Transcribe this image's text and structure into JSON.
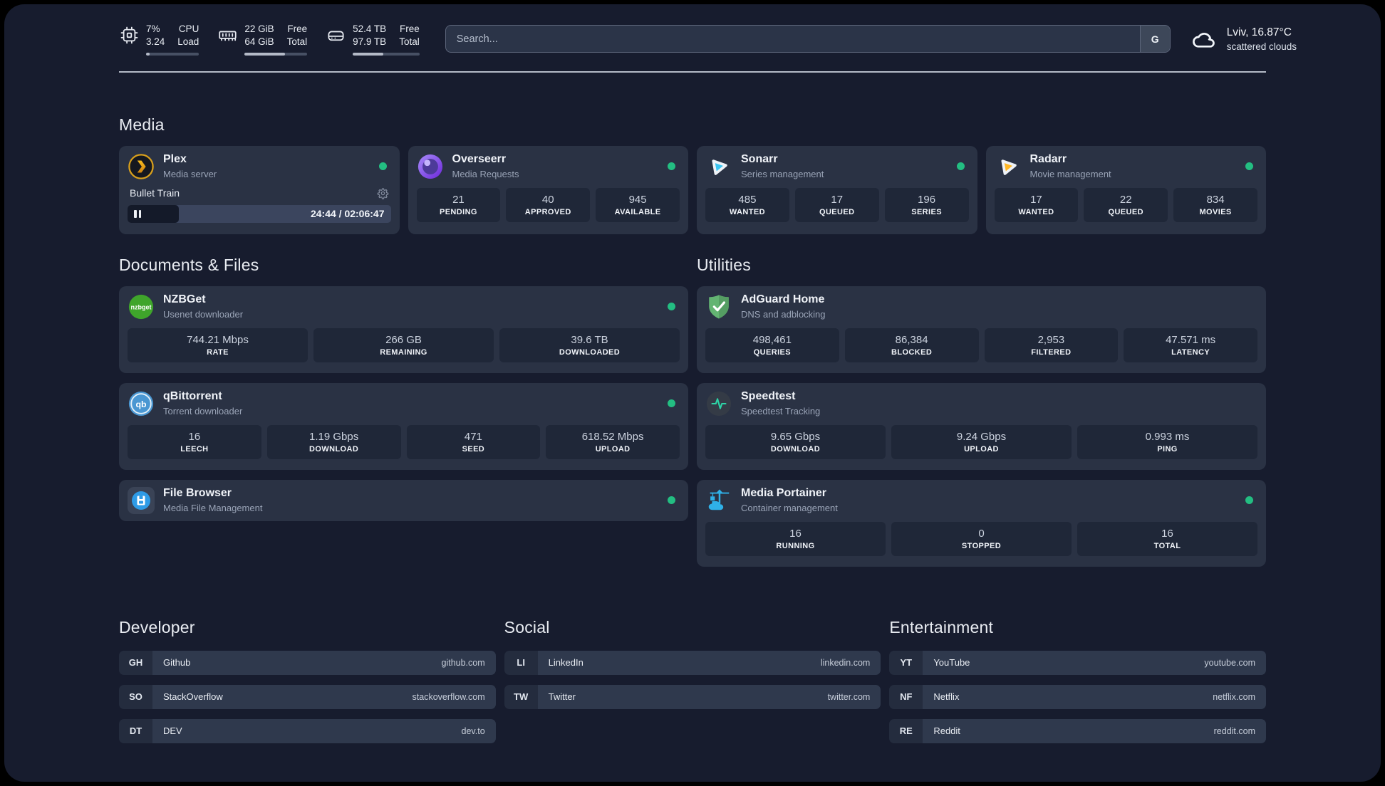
{
  "header": {
    "resources": [
      {
        "name": "cpu",
        "line1": "7%",
        "line2": "3.24",
        "label1": "CPU",
        "label2": "Load",
        "progress_pct": 7
      },
      {
        "name": "memory",
        "line1": "22 GiB",
        "line2": "64 GiB",
        "label1": "Free",
        "label2": "Total",
        "progress_pct": 64
      },
      {
        "name": "disk",
        "line1": "52.4 TB",
        "line2": "97.9 TB",
        "label1": "Free",
        "label2": "Total",
        "progress_pct": 46
      }
    ],
    "search": {
      "placeholder": "Search...",
      "button_label": "G"
    },
    "weather": {
      "title": "Lviv, 16.87°C",
      "subtitle": "scattered clouds"
    }
  },
  "media": {
    "title": "Media",
    "plex": {
      "name": "Plex",
      "description": "Media server",
      "status": "online",
      "player": {
        "title": "Bullet Train",
        "time": "24:44 / 02:06:47",
        "progress_pct": 19.5
      }
    },
    "overseerr": {
      "name": "Overseerr",
      "description": "Media Requests",
      "status": "online",
      "stats": [
        {
          "value": "21",
          "label": "PENDING"
        },
        {
          "value": "40",
          "label": "APPROVED"
        },
        {
          "value": "945",
          "label": "AVAILABLE"
        }
      ]
    },
    "sonarr": {
      "name": "Sonarr",
      "description": "Series management",
      "status": "online",
      "stats": [
        {
          "value": "485",
          "label": "WANTED"
        },
        {
          "value": "17",
          "label": "QUEUED"
        },
        {
          "value": "196",
          "label": "SERIES"
        }
      ]
    },
    "radarr": {
      "name": "Radarr",
      "description": "Movie management",
      "status": "online",
      "stats": [
        {
          "value": "17",
          "label": "WANTED"
        },
        {
          "value": "22",
          "label": "QUEUED"
        },
        {
          "value": "834",
          "label": "MOVIES"
        }
      ]
    }
  },
  "documents": {
    "title": "Documents & Files",
    "nzbget": {
      "name": "NZBGet",
      "description": "Usenet downloader",
      "status": "online",
      "stats": [
        {
          "value": "744.21 Mbps",
          "label": "RATE"
        },
        {
          "value": "266 GB",
          "label": "REMAINING"
        },
        {
          "value": "39.6 TB",
          "label": "DOWNLOADED"
        }
      ]
    },
    "qbittorrent": {
      "name": "qBittorrent",
      "description": "Torrent downloader",
      "status": "online",
      "stats": [
        {
          "value": "16",
          "label": "LEECH"
        },
        {
          "value": "1.19 Gbps",
          "label": "DOWNLOAD"
        },
        {
          "value": "471",
          "label": "SEED"
        },
        {
          "value": "618.52 Mbps",
          "label": "UPLOAD"
        }
      ]
    },
    "filebrowser": {
      "name": "File Browser",
      "description": "Media File Management",
      "status": "online"
    }
  },
  "utilities": {
    "title": "Utilities",
    "adguard": {
      "name": "AdGuard Home",
      "description": "DNS and adblocking",
      "stats": [
        {
          "value": "498,461",
          "label": "QUERIES"
        },
        {
          "value": "86,384",
          "label": "BLOCKED"
        },
        {
          "value": "2,953",
          "label": "FILTERED"
        },
        {
          "value": "47.571 ms",
          "label": "LATENCY"
        }
      ]
    },
    "speedtest": {
      "name": "Speedtest",
      "description": "Speedtest Tracking",
      "stats": [
        {
          "value": "9.65 Gbps",
          "label": "DOWNLOAD"
        },
        {
          "value": "9.24 Gbps",
          "label": "UPLOAD"
        },
        {
          "value": "0.993 ms",
          "label": "PING"
        }
      ]
    },
    "portainer": {
      "name": "Media Portainer",
      "description": "Container management",
      "status": "online",
      "stats": [
        {
          "value": "16",
          "label": "RUNNING"
        },
        {
          "value": "0",
          "label": "STOPPED"
        },
        {
          "value": "16",
          "label": "TOTAL"
        }
      ]
    }
  },
  "bookmarks": [
    {
      "title": "Developer",
      "links": [
        {
          "abbr": "GH",
          "name": "Github",
          "url": "github.com"
        },
        {
          "abbr": "SO",
          "name": "StackOverflow",
          "url": "stackoverflow.com"
        },
        {
          "abbr": "DT",
          "name": "DEV",
          "url": "dev.to"
        }
      ]
    },
    {
      "title": "Social",
      "links": [
        {
          "abbr": "LI",
          "name": "LinkedIn",
          "url": "linkedin.com"
        },
        {
          "abbr": "TW",
          "name": "Twitter",
          "url": "twitter.com"
        }
      ]
    },
    {
      "title": "Entertainment",
      "links": [
        {
          "abbr": "YT",
          "name": "YouTube",
          "url": "youtube.com"
        },
        {
          "abbr": "NF",
          "name": "Netflix",
          "url": "netflix.com"
        },
        {
          "abbr": "RE",
          "name": "Reddit",
          "url": "reddit.com"
        }
      ]
    }
  ],
  "colors": {
    "status_online": "#23be82",
    "background": "#171c2e",
    "card": "#2a3244",
    "stat_box": "#1f2738",
    "portainer_blue": "#2fb1e8"
  },
  "icons": [
    "cpu-icon",
    "memory-icon",
    "disk-icon",
    "cloud-icon",
    "search-provider-g",
    "gear-icon",
    "pause-icon",
    "plex-icon",
    "overseerr-icon",
    "sonarr-icon",
    "radarr-icon",
    "nzbget-icon",
    "qbittorrent-icon",
    "filebrowser-icon",
    "adguard-icon",
    "speedtest-icon",
    "portainer-icon",
    "status-online-dot"
  ]
}
